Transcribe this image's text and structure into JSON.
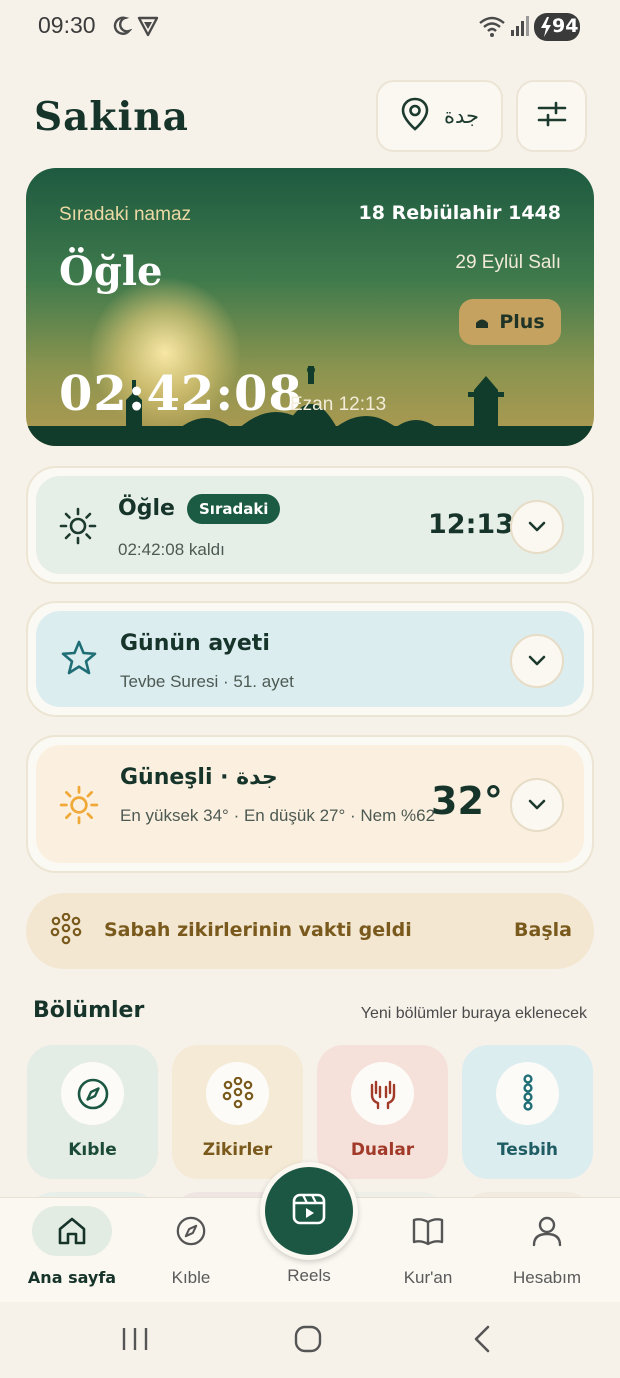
{
  "status_bar": {
    "time": "09:30",
    "battery": "94"
  },
  "header": {
    "title": "Sakina",
    "location": "جدة"
  },
  "hero": {
    "next_label": "Sıradaki namaz",
    "hijri_date": "18 Rebiülahir 1448",
    "prayer_name": "Öğle",
    "gregorian_date": "29 Eylül Salı",
    "plus_label": "Plus",
    "countdown": "02:42:08",
    "ezan_time": "Ezan 12:13"
  },
  "prayer_card": {
    "name": "Öğle",
    "badge": "Sıradaki",
    "remaining": "02:42:08 kaldı",
    "time": "12:13"
  },
  "verse_card": {
    "title": "Günün ayeti",
    "subtitle": "Tevbe Suresi · 51. ayet"
  },
  "weather_card": {
    "title": "Güneşli · جدة",
    "details": "En yüksek 34° · En düşük 27° · Nem %62",
    "temp": "32°"
  },
  "banner": {
    "text": "Sabah zikirlerinin vakti geldi",
    "action": "Başla"
  },
  "sections": {
    "title": "Bölümler",
    "note": "Yeni bölümler buraya eklenecek",
    "tiles": [
      {
        "label": "Kıble",
        "icon": "compass-icon"
      },
      {
        "label": "Zikirler",
        "icon": "prayer-beads-icon"
      },
      {
        "label": "Dualar",
        "icon": "praying-hands-icon"
      },
      {
        "label": "Tesbih",
        "icon": "tesbih-icon"
      }
    ]
  },
  "bottom_nav": {
    "items": [
      {
        "label": "Ana sayfa",
        "icon": "home-icon"
      },
      {
        "label": "Kıble",
        "icon": "compass-icon"
      },
      {
        "label": "Reels",
        "icon": "reels-icon"
      },
      {
        "label": "Kur'an",
        "icon": "book-icon"
      },
      {
        "label": "Hesabım",
        "icon": "user-icon"
      }
    ]
  },
  "colors": {
    "primary": "#1b5743",
    "background": "#f6f2ea",
    "accent_gold": "#c5a260",
    "sun_orange": "#f0a838"
  }
}
